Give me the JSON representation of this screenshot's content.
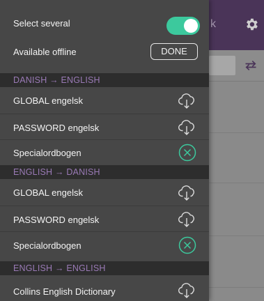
{
  "background": {
    "header_partial_text": "k",
    "gear_icon": "gear-icon",
    "swap_icon": "swap-icon"
  },
  "drawer": {
    "select_several": {
      "label": "Select several",
      "enabled": true
    },
    "available_offline": {
      "label": "Available offline",
      "done_label": "DONE"
    },
    "sections": [
      {
        "title": "DANISH → ENGLISH",
        "items": [
          {
            "label": "GLOBAL engelsk",
            "icon": "cloud-download-icon"
          },
          {
            "label": "PASSWORD engelsk",
            "icon": "cloud-download-icon"
          },
          {
            "label": "Specialordbogen",
            "icon": "remove-circle-icon"
          }
        ]
      },
      {
        "title": "ENGLISH → DANISH",
        "items": [
          {
            "label": "GLOBAL engelsk",
            "icon": "cloud-download-icon"
          },
          {
            "label": "PASSWORD engelsk",
            "icon": "cloud-download-icon"
          },
          {
            "label": "Specialordbogen",
            "icon": "remove-circle-icon"
          }
        ]
      },
      {
        "title": "ENGLISH → ENGLISH",
        "items": [
          {
            "label": "Collins English Dictionary",
            "icon": "cloud-download-icon"
          }
        ]
      }
    ]
  },
  "colors": {
    "accent": "#3cc99d",
    "section_title": "#9a7ab6",
    "drawer_bg": "#474747",
    "section_bg": "#2d2d2d",
    "header_bg": "#4a3458"
  }
}
